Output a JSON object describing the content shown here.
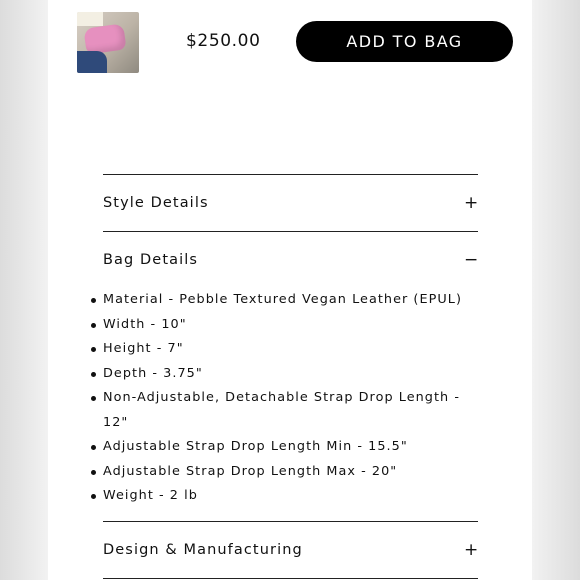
{
  "product": {
    "price": "$250.00",
    "add_to_bag_label": "ADD TO BAG",
    "thumbnail_alt": "product thumbnail"
  },
  "accordion": {
    "sections": [
      {
        "title": "Style Details",
        "toggle": "+",
        "expanded": false
      },
      {
        "title": "Bag Details",
        "toggle": "−",
        "expanded": true,
        "items": [
          "Material - Pebble Textured Vegan Leather (EPUL)",
          "Width - 10\"",
          "Height - 7\"",
          "Depth - 3.75\"",
          "Non-Adjustable, Detachable Strap Drop Length - 12\"",
          "Adjustable Strap Drop Length Min - 15.5\"",
          "Adjustable Strap Drop Length Max - 20\"",
          "Weight - 2 lb"
        ]
      },
      {
        "title": "Design & Manufacturing",
        "toggle": "+",
        "expanded": false
      }
    ]
  }
}
